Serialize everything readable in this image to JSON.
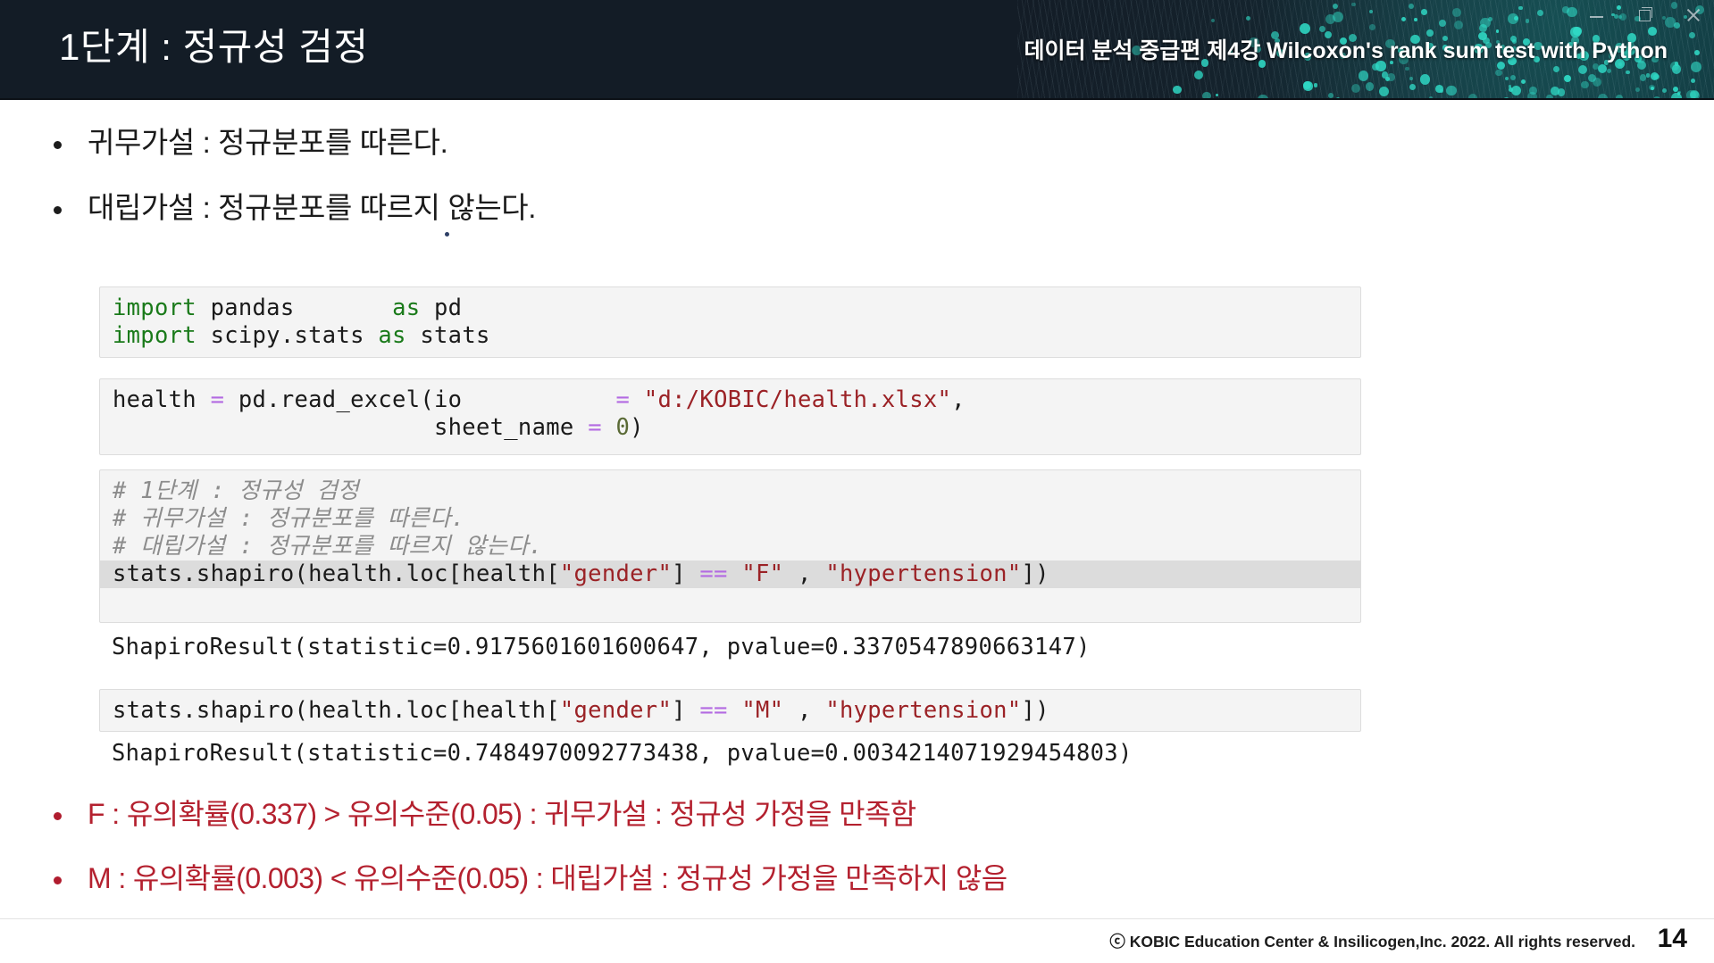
{
  "window": {
    "minimize_label": "minimize",
    "restore_label": "restore",
    "close_label": "close"
  },
  "header": {
    "title": "1단계 : 정규성 검정",
    "course": "데이터 분석 중급편 제4강 Wilcoxon's rank sum test with Python",
    "background_color": "#131c26",
    "accent_color": "#2fd9c5"
  },
  "bullets": [
    {
      "text": "귀무가설 : 정규분포를 따른다."
    },
    {
      "text": "대립가설 : 정규분포를 따르지 않는다."
    }
  ],
  "code_blocks": [
    {
      "name": "imports",
      "lines": [
        [
          {
            "t": "import",
            "c": "kw"
          },
          {
            "t": " pandas       ",
            "c": ""
          },
          {
            "t": "as",
            "c": "kw"
          },
          {
            "t": " pd",
            "c": ""
          }
        ],
        [
          {
            "t": "import",
            "c": "kw"
          },
          {
            "t": " scipy.stats ",
            "c": ""
          },
          {
            "t": "as",
            "c": "kw"
          },
          {
            "t": " stats",
            "c": ""
          }
        ]
      ]
    },
    {
      "name": "read-excel",
      "lines": [
        [
          {
            "t": "health ",
            "c": ""
          },
          {
            "t": "=",
            "c": "op"
          },
          {
            "t": " pd.read_excel(io           ",
            "c": ""
          },
          {
            "t": "=",
            "c": "op"
          },
          {
            "t": " ",
            "c": ""
          },
          {
            "t": "\"d:/KOBIC/health.xlsx\"",
            "c": "str"
          },
          {
            "t": ",",
            "c": ""
          }
        ],
        [
          {
            "t": "                       sheet_name ",
            "c": ""
          },
          {
            "t": "=",
            "c": "op"
          },
          {
            "t": " ",
            "c": ""
          },
          {
            "t": "0",
            "c": "num"
          },
          {
            "t": ")",
            "c": ""
          }
        ]
      ]
    },
    {
      "name": "shapiro-female",
      "lines": [
        [
          {
            "t": "# 1단계 : 정규성 검정",
            "c": "cmt"
          }
        ],
        [
          {
            "t": "# 귀무가설 : 정규분포를 따른다.",
            "c": "cmt"
          }
        ],
        [
          {
            "t": "# 대립가설 : 정규분포를 따르지 않는다.",
            "c": "cmt"
          }
        ],
        [
          {
            "t": "stats.shapiro(health.loc[health[",
            "c": ""
          },
          {
            "t": "\"gender\"",
            "c": "str"
          },
          {
            "t": "] ",
            "c": ""
          },
          {
            "t": "==",
            "c": "op"
          },
          {
            "t": " ",
            "c": ""
          },
          {
            "t": "\"F\"",
            "c": "str"
          },
          {
            "t": " , ",
            "c": ""
          },
          {
            "t": "\"hypertension\"",
            "c": "str"
          },
          {
            "t": "])",
            "c": ""
          }
        ]
      ],
      "highlighted_line_index": 3
    },
    {
      "name": "shapiro-male",
      "lines": [
        [
          {
            "t": "stats.shapiro(health.loc[health[",
            "c": ""
          },
          {
            "t": "\"gender\"",
            "c": "str"
          },
          {
            "t": "] ",
            "c": ""
          },
          {
            "t": "==",
            "c": "op"
          },
          {
            "t": " ",
            "c": ""
          },
          {
            "t": "\"M\"",
            "c": "str"
          },
          {
            "t": " , ",
            "c": ""
          },
          {
            "t": "\"hypertension\"",
            "c": "str"
          },
          {
            "t": "])",
            "c": ""
          }
        ]
      ]
    }
  ],
  "outputs": [
    {
      "name": "shapiro-female-result",
      "text": "ShapiroResult(statistic=0.9175601601600647, pvalue=0.3370547890663147)"
    },
    {
      "name": "shapiro-male-result",
      "text": "ShapiroResult(statistic=0.7484970092773438, pvalue=0.0034214071929454803)"
    }
  ],
  "conclusions": [
    {
      "text": "F : 유의확률(0.337) > 유의수준(0.05) : 귀무가설 : 정규성 가정을 만족함"
    },
    {
      "text": "M : 유의확률(0.003) < 유의수준(0.05) : 대립가설 : 정규성 가정을 만족하지 않음"
    }
  ],
  "footer": {
    "copyright": "ⓒ KOBIC Education Center & Insilicogen,Inc. 2022. All rights reserved.",
    "page_number": "14"
  },
  "colors": {
    "conclusion_red": "#b4212f",
    "keyword_green": "#1a7a1a",
    "operator_purple": "#b36ae2",
    "string_maroon": "#9b2226",
    "code_background": "#f4f4f4"
  }
}
